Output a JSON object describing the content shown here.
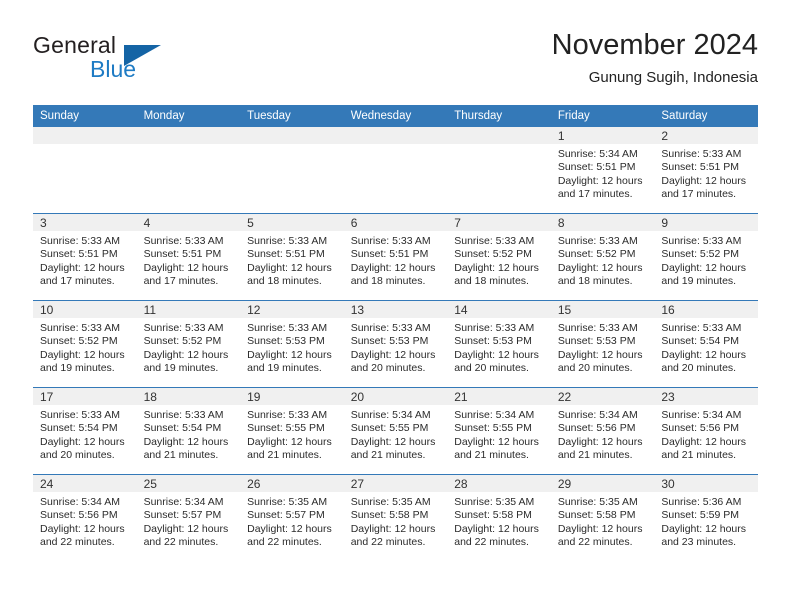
{
  "logo": {
    "text_primary": "General",
    "text_secondary": "Blue",
    "triangle_color": "#1464a5",
    "secondary_color": "#1e7bc4"
  },
  "header": {
    "title": "November 2024",
    "subtitle": "Gunung Sugih, Indonesia",
    "accent_color": "#3479b8"
  },
  "calendar": {
    "weekday_headers": [
      "Sunday",
      "Monday",
      "Tuesday",
      "Wednesday",
      "Thursday",
      "Friday",
      "Saturday"
    ],
    "weeks": [
      [
        {
          "day": "",
          "empty": true,
          "sunrise": "",
          "sunset": "",
          "daylight_line1": "",
          "daylight_line2": ""
        },
        {
          "day": "",
          "empty": true,
          "sunrise": "",
          "sunset": "",
          "daylight_line1": "",
          "daylight_line2": ""
        },
        {
          "day": "",
          "empty": true,
          "sunrise": "",
          "sunset": "",
          "daylight_line1": "",
          "daylight_line2": ""
        },
        {
          "day": "",
          "empty": true,
          "sunrise": "",
          "sunset": "",
          "daylight_line1": "",
          "daylight_line2": ""
        },
        {
          "day": "",
          "empty": true,
          "sunrise": "",
          "sunset": "",
          "daylight_line1": "",
          "daylight_line2": ""
        },
        {
          "day": "1",
          "sunrise": "Sunrise: 5:34 AM",
          "sunset": "Sunset: 5:51 PM",
          "daylight_line1": "Daylight: 12 hours",
          "daylight_line2": "and 17 minutes."
        },
        {
          "day": "2",
          "sunrise": "Sunrise: 5:33 AM",
          "sunset": "Sunset: 5:51 PM",
          "daylight_line1": "Daylight: 12 hours",
          "daylight_line2": "and 17 minutes."
        }
      ],
      [
        {
          "day": "3",
          "sunrise": "Sunrise: 5:33 AM",
          "sunset": "Sunset: 5:51 PM",
          "daylight_line1": "Daylight: 12 hours",
          "daylight_line2": "and 17 minutes."
        },
        {
          "day": "4",
          "sunrise": "Sunrise: 5:33 AM",
          "sunset": "Sunset: 5:51 PM",
          "daylight_line1": "Daylight: 12 hours",
          "daylight_line2": "and 17 minutes."
        },
        {
          "day": "5",
          "sunrise": "Sunrise: 5:33 AM",
          "sunset": "Sunset: 5:51 PM",
          "daylight_line1": "Daylight: 12 hours",
          "daylight_line2": "and 18 minutes."
        },
        {
          "day": "6",
          "sunrise": "Sunrise: 5:33 AM",
          "sunset": "Sunset: 5:51 PM",
          "daylight_line1": "Daylight: 12 hours",
          "daylight_line2": "and 18 minutes."
        },
        {
          "day": "7",
          "sunrise": "Sunrise: 5:33 AM",
          "sunset": "Sunset: 5:52 PM",
          "daylight_line1": "Daylight: 12 hours",
          "daylight_line2": "and 18 minutes."
        },
        {
          "day": "8",
          "sunrise": "Sunrise: 5:33 AM",
          "sunset": "Sunset: 5:52 PM",
          "daylight_line1": "Daylight: 12 hours",
          "daylight_line2": "and 18 minutes."
        },
        {
          "day": "9",
          "sunrise": "Sunrise: 5:33 AM",
          "sunset": "Sunset: 5:52 PM",
          "daylight_line1": "Daylight: 12 hours",
          "daylight_line2": "and 19 minutes."
        }
      ],
      [
        {
          "day": "10",
          "sunrise": "Sunrise: 5:33 AM",
          "sunset": "Sunset: 5:52 PM",
          "daylight_line1": "Daylight: 12 hours",
          "daylight_line2": "and 19 minutes."
        },
        {
          "day": "11",
          "sunrise": "Sunrise: 5:33 AM",
          "sunset": "Sunset: 5:52 PM",
          "daylight_line1": "Daylight: 12 hours",
          "daylight_line2": "and 19 minutes."
        },
        {
          "day": "12",
          "sunrise": "Sunrise: 5:33 AM",
          "sunset": "Sunset: 5:53 PM",
          "daylight_line1": "Daylight: 12 hours",
          "daylight_line2": "and 19 minutes."
        },
        {
          "day": "13",
          "sunrise": "Sunrise: 5:33 AM",
          "sunset": "Sunset: 5:53 PM",
          "daylight_line1": "Daylight: 12 hours",
          "daylight_line2": "and 20 minutes."
        },
        {
          "day": "14",
          "sunrise": "Sunrise: 5:33 AM",
          "sunset": "Sunset: 5:53 PM",
          "daylight_line1": "Daylight: 12 hours",
          "daylight_line2": "and 20 minutes."
        },
        {
          "day": "15",
          "sunrise": "Sunrise: 5:33 AM",
          "sunset": "Sunset: 5:53 PM",
          "daylight_line1": "Daylight: 12 hours",
          "daylight_line2": "and 20 minutes."
        },
        {
          "day": "16",
          "sunrise": "Sunrise: 5:33 AM",
          "sunset": "Sunset: 5:54 PM",
          "daylight_line1": "Daylight: 12 hours",
          "daylight_line2": "and 20 minutes."
        }
      ],
      [
        {
          "day": "17",
          "sunrise": "Sunrise: 5:33 AM",
          "sunset": "Sunset: 5:54 PM",
          "daylight_line1": "Daylight: 12 hours",
          "daylight_line2": "and 20 minutes."
        },
        {
          "day": "18",
          "sunrise": "Sunrise: 5:33 AM",
          "sunset": "Sunset: 5:54 PM",
          "daylight_line1": "Daylight: 12 hours",
          "daylight_line2": "and 21 minutes."
        },
        {
          "day": "19",
          "sunrise": "Sunrise: 5:33 AM",
          "sunset": "Sunset: 5:55 PM",
          "daylight_line1": "Daylight: 12 hours",
          "daylight_line2": "and 21 minutes."
        },
        {
          "day": "20",
          "sunrise": "Sunrise: 5:34 AM",
          "sunset": "Sunset: 5:55 PM",
          "daylight_line1": "Daylight: 12 hours",
          "daylight_line2": "and 21 minutes."
        },
        {
          "day": "21",
          "sunrise": "Sunrise: 5:34 AM",
          "sunset": "Sunset: 5:55 PM",
          "daylight_line1": "Daylight: 12 hours",
          "daylight_line2": "and 21 minutes."
        },
        {
          "day": "22",
          "sunrise": "Sunrise: 5:34 AM",
          "sunset": "Sunset: 5:56 PM",
          "daylight_line1": "Daylight: 12 hours",
          "daylight_line2": "and 21 minutes."
        },
        {
          "day": "23",
          "sunrise": "Sunrise: 5:34 AM",
          "sunset": "Sunset: 5:56 PM",
          "daylight_line1": "Daylight: 12 hours",
          "daylight_line2": "and 21 minutes."
        }
      ],
      [
        {
          "day": "24",
          "sunrise": "Sunrise: 5:34 AM",
          "sunset": "Sunset: 5:56 PM",
          "daylight_line1": "Daylight: 12 hours",
          "daylight_line2": "and 22 minutes."
        },
        {
          "day": "25",
          "sunrise": "Sunrise: 5:34 AM",
          "sunset": "Sunset: 5:57 PM",
          "daylight_line1": "Daylight: 12 hours",
          "daylight_line2": "and 22 minutes."
        },
        {
          "day": "26",
          "sunrise": "Sunrise: 5:35 AM",
          "sunset": "Sunset: 5:57 PM",
          "daylight_line1": "Daylight: 12 hours",
          "daylight_line2": "and 22 minutes."
        },
        {
          "day": "27",
          "sunrise": "Sunrise: 5:35 AM",
          "sunset": "Sunset: 5:58 PM",
          "daylight_line1": "Daylight: 12 hours",
          "daylight_line2": "and 22 minutes."
        },
        {
          "day": "28",
          "sunrise": "Sunrise: 5:35 AM",
          "sunset": "Sunset: 5:58 PM",
          "daylight_line1": "Daylight: 12 hours",
          "daylight_line2": "and 22 minutes."
        },
        {
          "day": "29",
          "sunrise": "Sunrise: 5:35 AM",
          "sunset": "Sunset: 5:58 PM",
          "daylight_line1": "Daylight: 12 hours",
          "daylight_line2": "and 22 minutes."
        },
        {
          "day": "30",
          "sunrise": "Sunrise: 5:36 AM",
          "sunset": "Sunset: 5:59 PM",
          "daylight_line1": "Daylight: 12 hours",
          "daylight_line2": "and 23 minutes."
        }
      ]
    ]
  }
}
